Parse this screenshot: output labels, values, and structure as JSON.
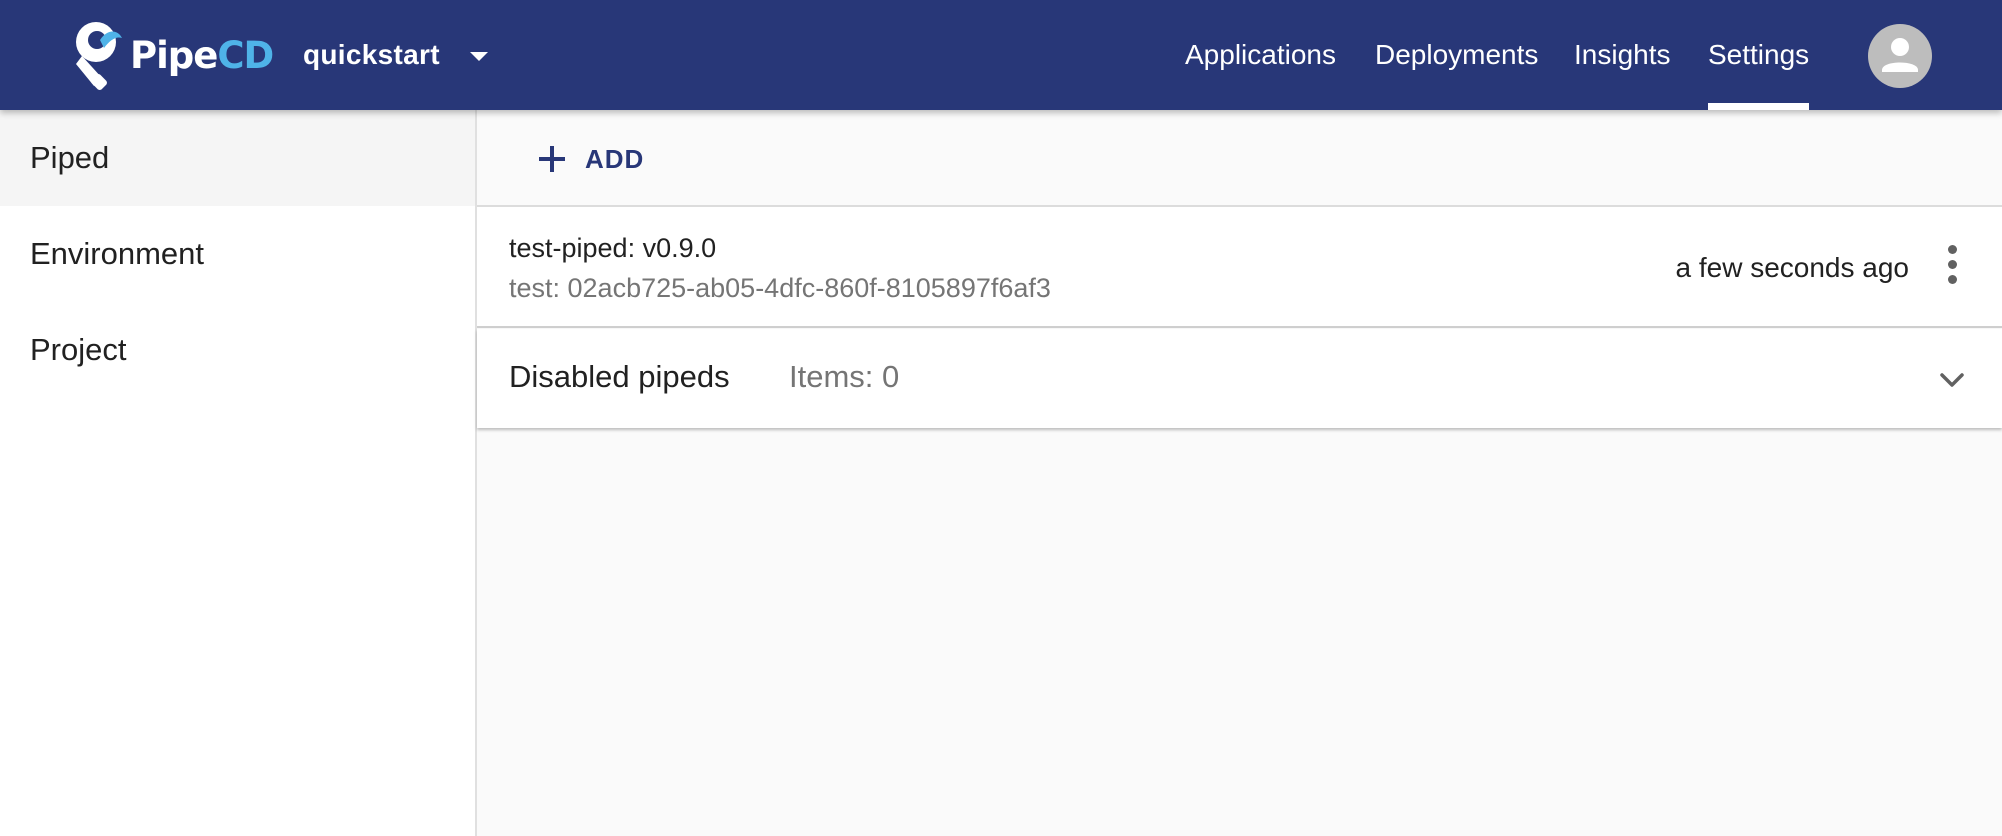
{
  "app": {
    "logo": {
      "text_main": "Pipe",
      "text_accent": "CD"
    },
    "project": {
      "selected": "quickstart"
    }
  },
  "nav": {
    "items": [
      {
        "label": "Applications",
        "active": false
      },
      {
        "label": "Deployments",
        "active": false
      },
      {
        "label": "Insights",
        "active": false
      },
      {
        "label": "Settings",
        "active": true
      }
    ]
  },
  "user": {
    "avatar_icon": "account-circle-icon"
  },
  "sidebar": {
    "items": [
      {
        "label": "Piped",
        "active": true
      },
      {
        "label": "Environment",
        "active": false
      },
      {
        "label": "Project",
        "active": false
      }
    ]
  },
  "toolbar": {
    "add_label": "ADD",
    "add_icon": "plus-icon"
  },
  "pipeds": [
    {
      "name_line": "test-piped: v0.9.0",
      "desc_line": "test: 02acb725-ab05-4dfc-860f-8105897f6af3",
      "time": "a few seconds ago",
      "menu_icon": "more-vert-icon"
    }
  ],
  "disabled_pipeds": {
    "title": "Disabled pipeds",
    "count_label": "Items: 0",
    "expand_icon": "chevron-down-icon"
  },
  "colors": {
    "appbar": "#283778",
    "accent": "#4fb3e8",
    "primary_text": "#212121",
    "secondary_text": "#757575",
    "avatar_bg": "#bdbdbd"
  }
}
